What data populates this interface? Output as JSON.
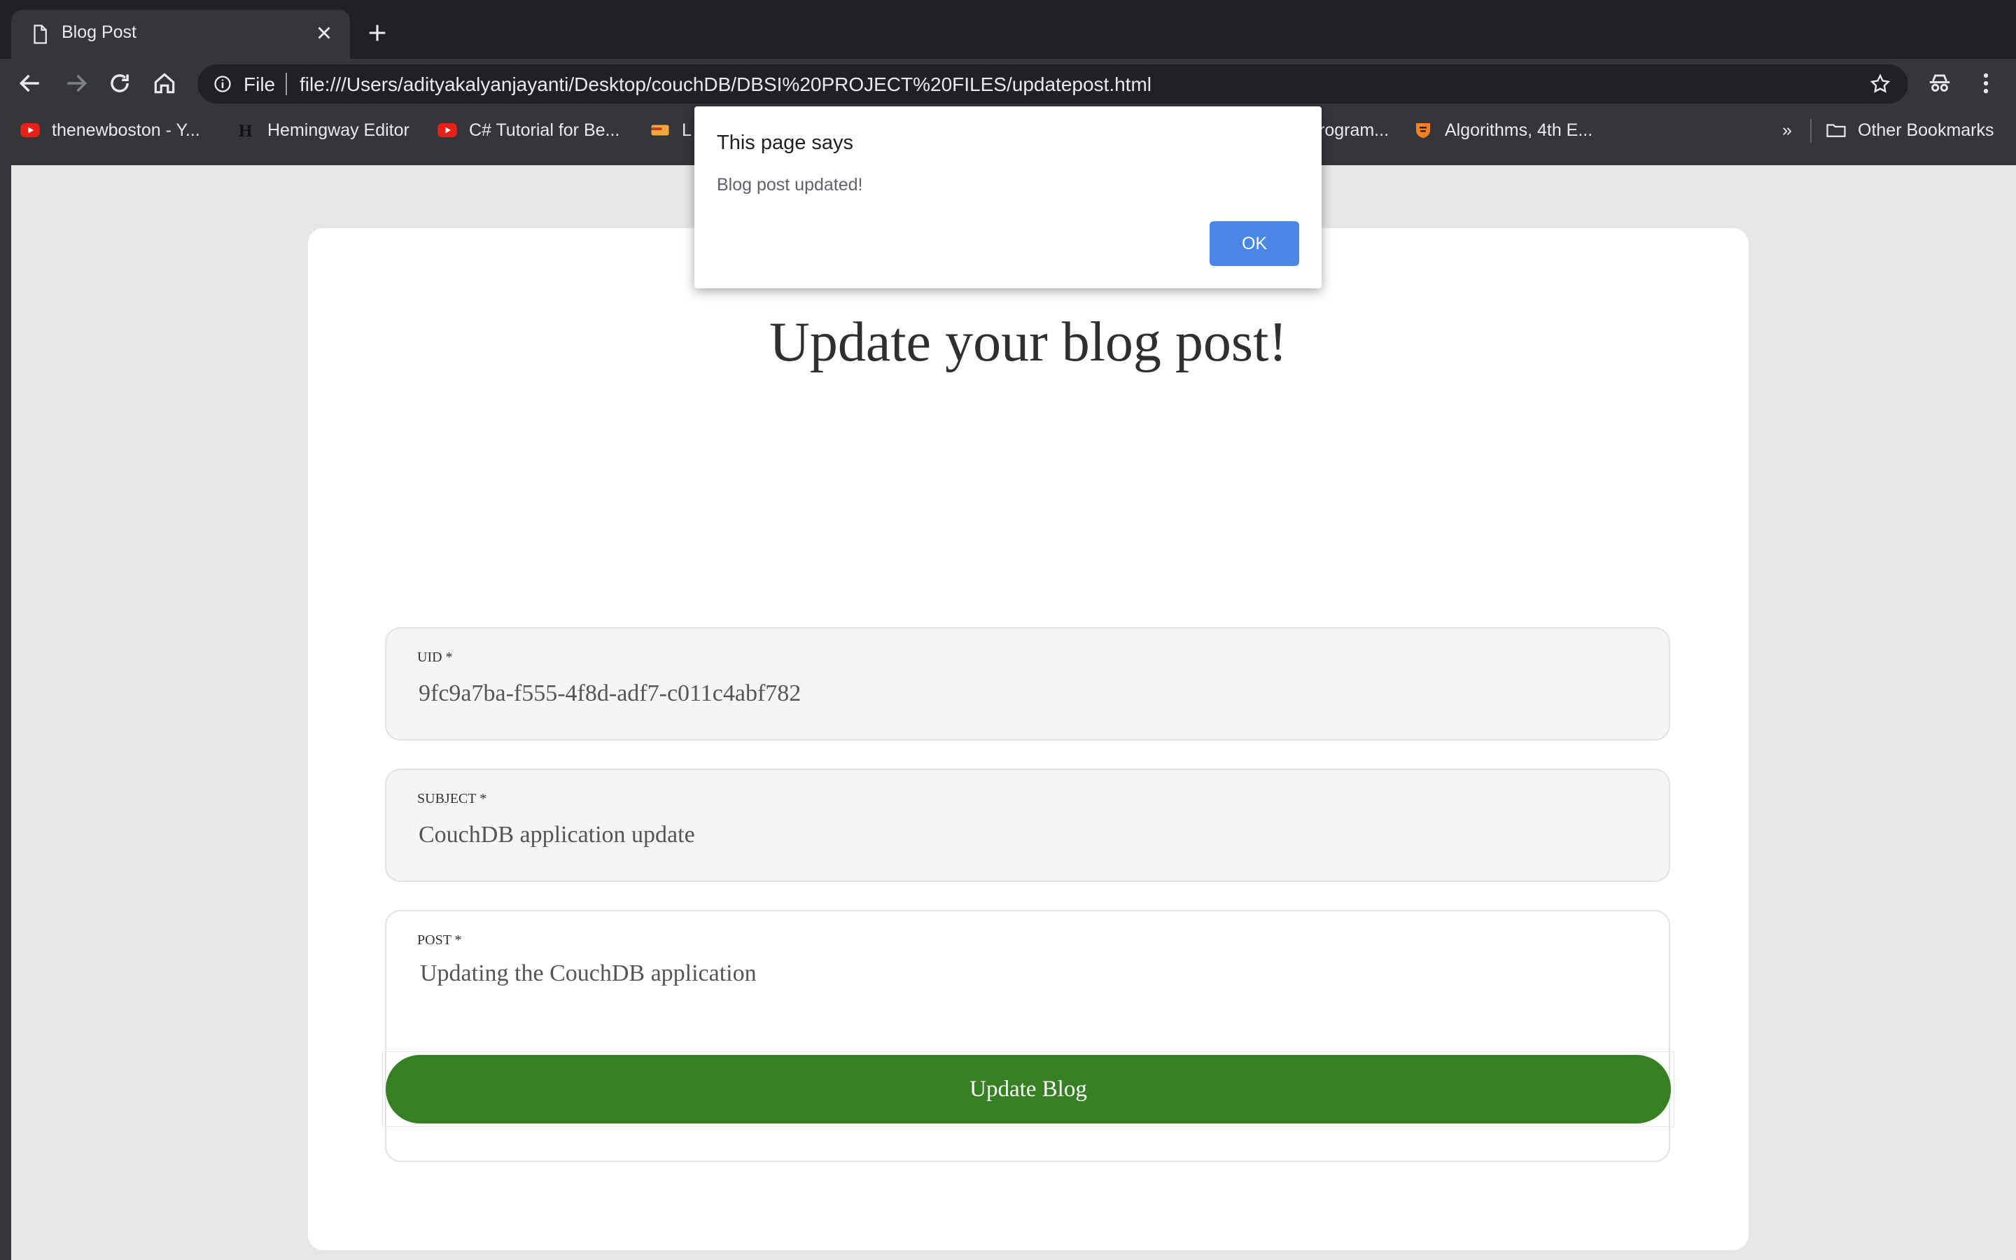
{
  "browser": {
    "tab": {
      "title": "Blog Post"
    },
    "omnibox": {
      "scheme_label": "File",
      "url": "file:///Users/adityakalyanjayanti/Desktop/couchDB/DBSI%20PROJECT%20FILES/updatepost.html"
    },
    "bookmarks": [
      {
        "label": "thenewboston - Y...",
        "icon": "youtube-icon"
      },
      {
        "label": "Hemingway Editor",
        "icon": "hemingway-icon"
      },
      {
        "label": "C# Tutorial for Be...",
        "icon": "youtube-icon"
      },
      {
        "label": "L",
        "icon": "bookmark-favicon-icon"
      },
      {
        "label": "rogram...",
        "icon": "bookmark-text"
      },
      {
        "label": "Algorithms, 4th E...",
        "icon": "princeton-icon"
      }
    ],
    "overflow_label": "»",
    "other_bookmarks": "Other Bookmarks"
  },
  "page": {
    "heading": "Update your blog post!",
    "fields": {
      "uid": {
        "label": "UID *",
        "value": "9fc9a7ba-f555-4f8d-adf7-c011c4abf782"
      },
      "subject": {
        "label": "SUBJECT *",
        "value": "CouchDB application update"
      },
      "post": {
        "label": "POST *",
        "value": "Updating the CouchDB application"
      }
    },
    "submit_label": "Update Blog"
  },
  "dialog": {
    "title": "This page says",
    "message": "Blog post updated!",
    "ok_label": "OK"
  },
  "colors": {
    "accent_blue": "#4a86e8",
    "button_green": "#367f23",
    "chrome_dark": "#35363a"
  }
}
